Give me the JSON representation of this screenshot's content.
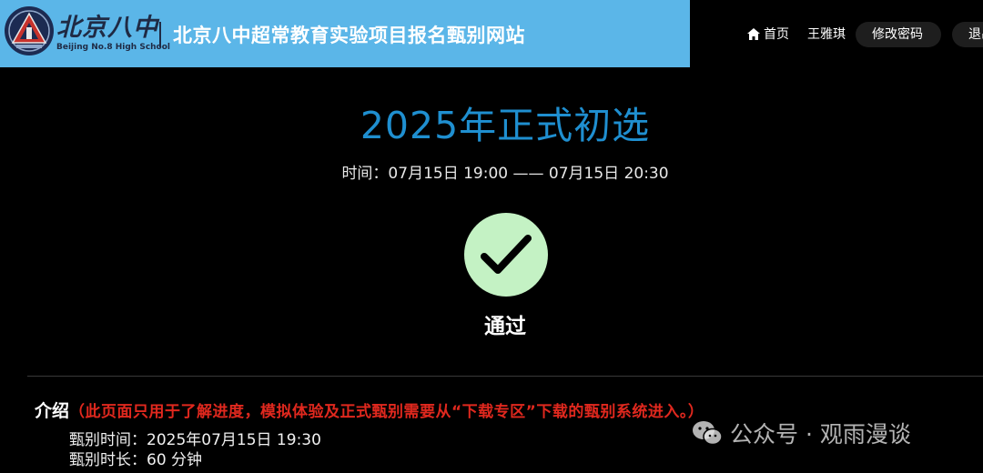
{
  "header": {
    "logo_cn": "北京八中",
    "logo_en": "Beijing No.8 High School",
    "site_title": "北京八中超常教育实验项目报名甄别网站"
  },
  "nav": {
    "home": "首页",
    "user": "王雅琪",
    "change_password": "修改密码",
    "logout": "退出"
  },
  "exam": {
    "title": "2025年正式初选",
    "time": "时间：07月15日 19:00 —— 07月15日 20:30",
    "status": "通过",
    "status_color": "#c4f2c4"
  },
  "intro": {
    "label": "介绍",
    "note": "（此页面只用于了解进度，模拟体验及正式甄别需要从“下载专区”下载的甄别系统进入。）",
    "details": [
      "甄别时间：2025年07月15日 19:30",
      "甄别时长：60 分钟"
    ]
  },
  "watermark": {
    "text": "公众号 · 观雨漫谈",
    "icon": "wechat-icon"
  },
  "colors": {
    "banner": "#5bb6e8",
    "title_blue": "#1f8fd0",
    "note_red": "#e0281e"
  }
}
